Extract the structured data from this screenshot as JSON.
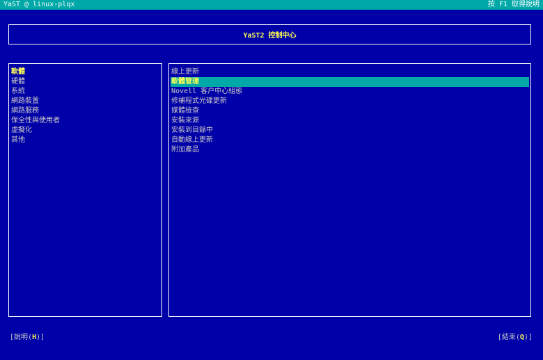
{
  "topbar": {
    "left_text": "YaST @ linux-plqx",
    "right_text": "按 F1 取得說明"
  },
  "header": {
    "title": "YaST2 控制中心"
  },
  "categories": [
    {
      "label": "軟體"
    },
    {
      "label": "硬體"
    },
    {
      "label": "系統"
    },
    {
      "label": "網路裝置"
    },
    {
      "label": "網路服務"
    },
    {
      "label": "保全性與使用者"
    },
    {
      "label": "虛擬化"
    },
    {
      "label": "其他"
    }
  ],
  "modules": [
    {
      "label": "線上更新"
    },
    {
      "label": "軟體管理"
    },
    {
      "label": "Novell 客户中心組態"
    },
    {
      "label": "修補程式光碟更新"
    },
    {
      "label": "媒體檢查"
    },
    {
      "label": "安裝來源"
    },
    {
      "label": "安裝到目錄中"
    },
    {
      "label": "自動線上更新"
    },
    {
      "label": "附加產品"
    }
  ],
  "buttons": {
    "help": {
      "open": "[",
      "label": "說明(",
      "hotkey": "H",
      "close": ")]"
    },
    "quit": {
      "open": "[",
      "label": "結束(",
      "hotkey": "Q",
      "close": ")]"
    }
  },
  "colors": {
    "background": "#0000a8",
    "accent": "#00a8a8",
    "highlight_text": "#ffff54",
    "text": "#c8c8c8"
  }
}
